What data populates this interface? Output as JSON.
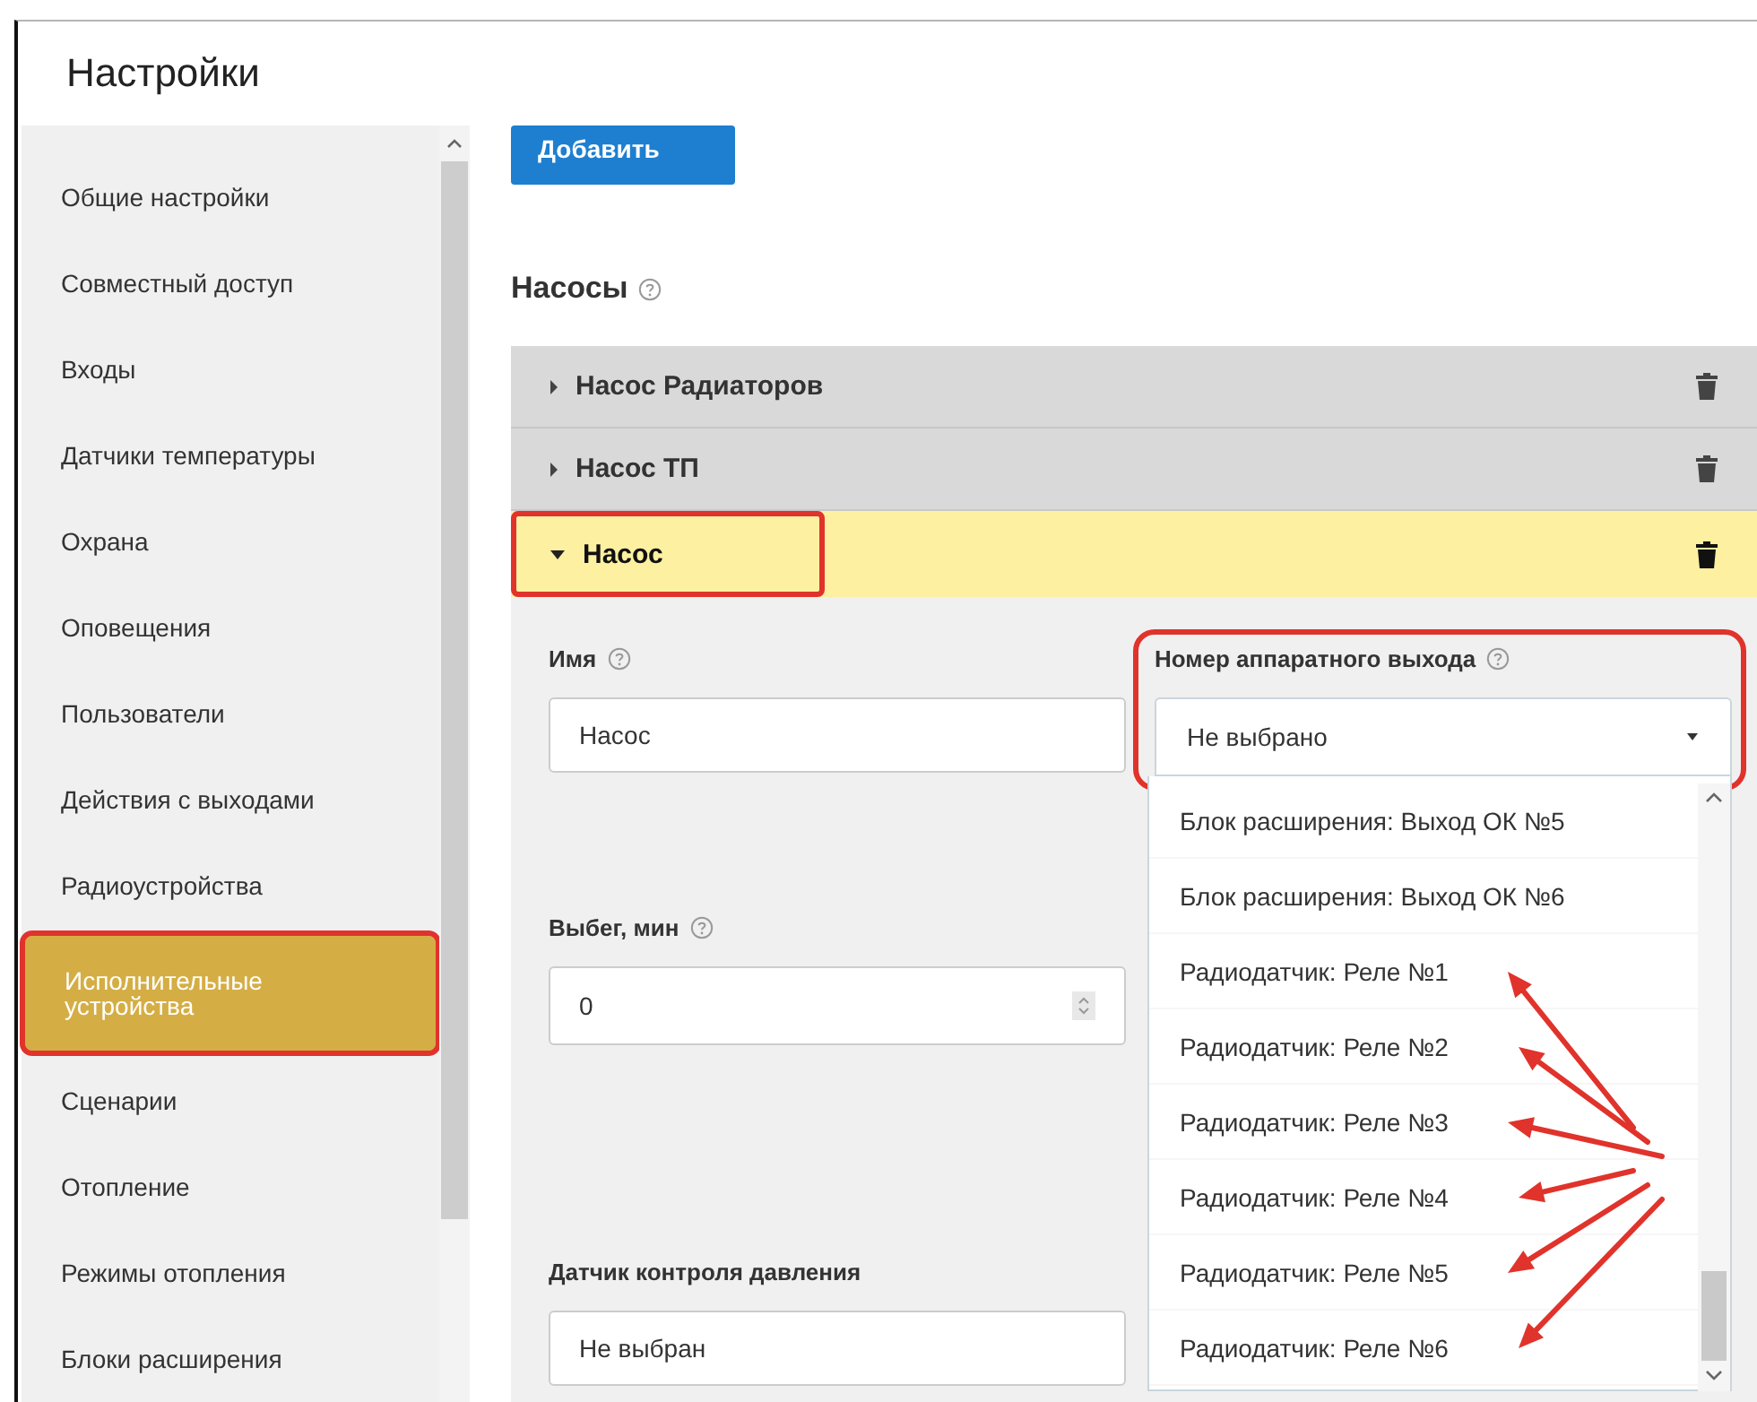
{
  "title": "Настройки",
  "sidebar": {
    "items": [
      {
        "label": "Общие настройки",
        "selected": false,
        "highlighted": false
      },
      {
        "label": "Совместный доступ",
        "selected": false,
        "highlighted": false
      },
      {
        "label": "Входы",
        "selected": false,
        "highlighted": false
      },
      {
        "label": "Датчики температуры",
        "selected": false,
        "highlighted": false
      },
      {
        "label": "Охрана",
        "selected": false,
        "highlighted": false
      },
      {
        "label": "Оповещения",
        "selected": false,
        "highlighted": false
      },
      {
        "label": "Пользователи",
        "selected": false,
        "highlighted": false
      },
      {
        "label": "Действия с выходами",
        "selected": false,
        "highlighted": false
      },
      {
        "label": "Радиоустройства",
        "selected": false,
        "highlighted": false
      },
      {
        "label": "Исполнительные устройства",
        "selected": true,
        "highlighted": true
      },
      {
        "label": "Сценарии",
        "selected": false,
        "highlighted": false
      },
      {
        "label": "Отопление",
        "selected": false,
        "highlighted": false
      },
      {
        "label": "Режимы отопления",
        "selected": false,
        "highlighted": false
      },
      {
        "label": "Блоки расширения",
        "selected": false,
        "highlighted": false
      }
    ]
  },
  "add_button": "Добавить",
  "section": {
    "title": "Насосы"
  },
  "pumps": [
    {
      "name": "Насос Радиаторов",
      "expanded": false,
      "highlighted": false
    },
    {
      "name": "Насос ТП",
      "expanded": false,
      "highlighted": false
    },
    {
      "name": "Насос",
      "expanded": true,
      "highlighted": true
    }
  ],
  "form": {
    "name_field": {
      "label": "Имя",
      "value": "Насос"
    },
    "runout_field": {
      "label": "Выбег, мин",
      "value": "0"
    },
    "pressure_sensor": {
      "label": "Датчик контроля давления",
      "value": "Не выбран"
    },
    "output": {
      "label": "Номер аппаратного выхода",
      "value": "Не выбрано",
      "highlighted": true,
      "expanded": true,
      "options": [
        {
          "label": "Блок расширения: Выход ОК №5",
          "pointed": false
        },
        {
          "label": "Блок расширения: Выход ОК №6",
          "pointed": false
        },
        {
          "label": "Радиодатчик: Реле №1",
          "pointed": true
        },
        {
          "label": "Радиодатчик: Реле №2",
          "pointed": true
        },
        {
          "label": "Радиодатчик: Реле №3",
          "pointed": true
        },
        {
          "label": "Радиодатчик: Реле №4",
          "pointed": true
        },
        {
          "label": "Радиодатчик: Реле №5",
          "pointed": true
        },
        {
          "label": "Радиодатчик: Реле №6",
          "pointed": true
        }
      ]
    }
  }
}
